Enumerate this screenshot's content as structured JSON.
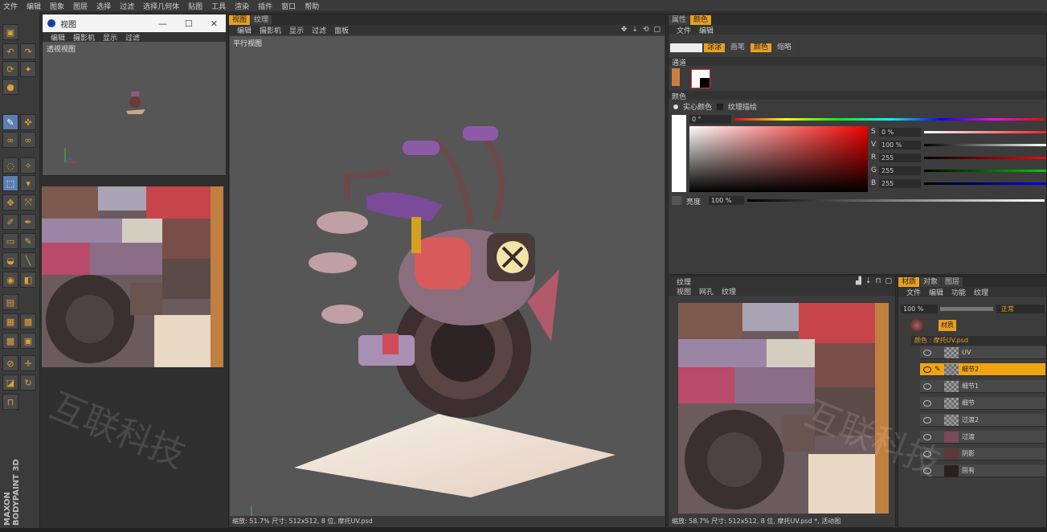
{
  "menubar": [
    "文件",
    "编辑",
    "图象",
    "图层",
    "选择",
    "过滤",
    "选择几何体",
    "贴图",
    "工具",
    "渲染",
    "插件",
    "窗口",
    "帮助"
  ],
  "brand": [
    "MAXON",
    "BODYPAINT 3D"
  ],
  "float_view": {
    "title": "视图",
    "win_controls": [
      "—",
      "☐",
      "✕"
    ],
    "menu": [
      "编辑",
      "摄影机",
      "显示",
      "过滤"
    ],
    "label": "透视视图"
  },
  "center": {
    "tabs": [
      "视图",
      "纹理"
    ],
    "menu": [
      "编辑",
      "摄影机",
      "显示",
      "过滤",
      "面板"
    ],
    "label": "平行视图",
    "status": "缩放: 51.7%  尺寸: 512x512, 8 位, 摩托UV.psd"
  },
  "attributes": {
    "tabs": [
      "属性",
      "颜色"
    ],
    "menu": [
      "文件",
      "编辑"
    ],
    "mode_tabs": [
      "涂涂",
      "画笔",
      "颜色",
      "缩略"
    ],
    "section_channels": "通道",
    "section_color": "颜色",
    "radio_solid": "实心颜色",
    "radio_texture": "纹理描绘",
    "top_value": "0 °",
    "hsv": [
      {
        "label": "S",
        "value": "0 %"
      },
      {
        "label": "V",
        "value": "100 %"
      },
      {
        "label": "R",
        "value": "255"
      },
      {
        "label": "G",
        "value": "255"
      },
      {
        "label": "B",
        "value": "255"
      }
    ],
    "brightness_label": "亮度",
    "brightness_value": "100 %"
  },
  "texture_panel": {
    "title": "纹理",
    "menu": [
      "视图",
      "网孔",
      "纹理"
    ],
    "status": "缩放: 58.7%  尺寸: 512x512, 8 位, 摩托UV.psd *, 活动图"
  },
  "layers_panel": {
    "tabs": [
      "材质",
      "对象",
      "图层"
    ],
    "menu": [
      "文件",
      "编辑",
      "功能",
      "纹理"
    ],
    "opacity": "100 %",
    "blend": "正常",
    "material": "材质",
    "channel": "颜色 : 摩托UV.psd",
    "layers": [
      "UV",
      "细节2",
      "细节1",
      "细节",
      "过渡2",
      "过渡",
      "阴影",
      "固有"
    ],
    "selected_index": 1
  },
  "watermark": "互联科技",
  "colors": {
    "accent": "#e9a020",
    "selected_layer": "#f0a412"
  }
}
